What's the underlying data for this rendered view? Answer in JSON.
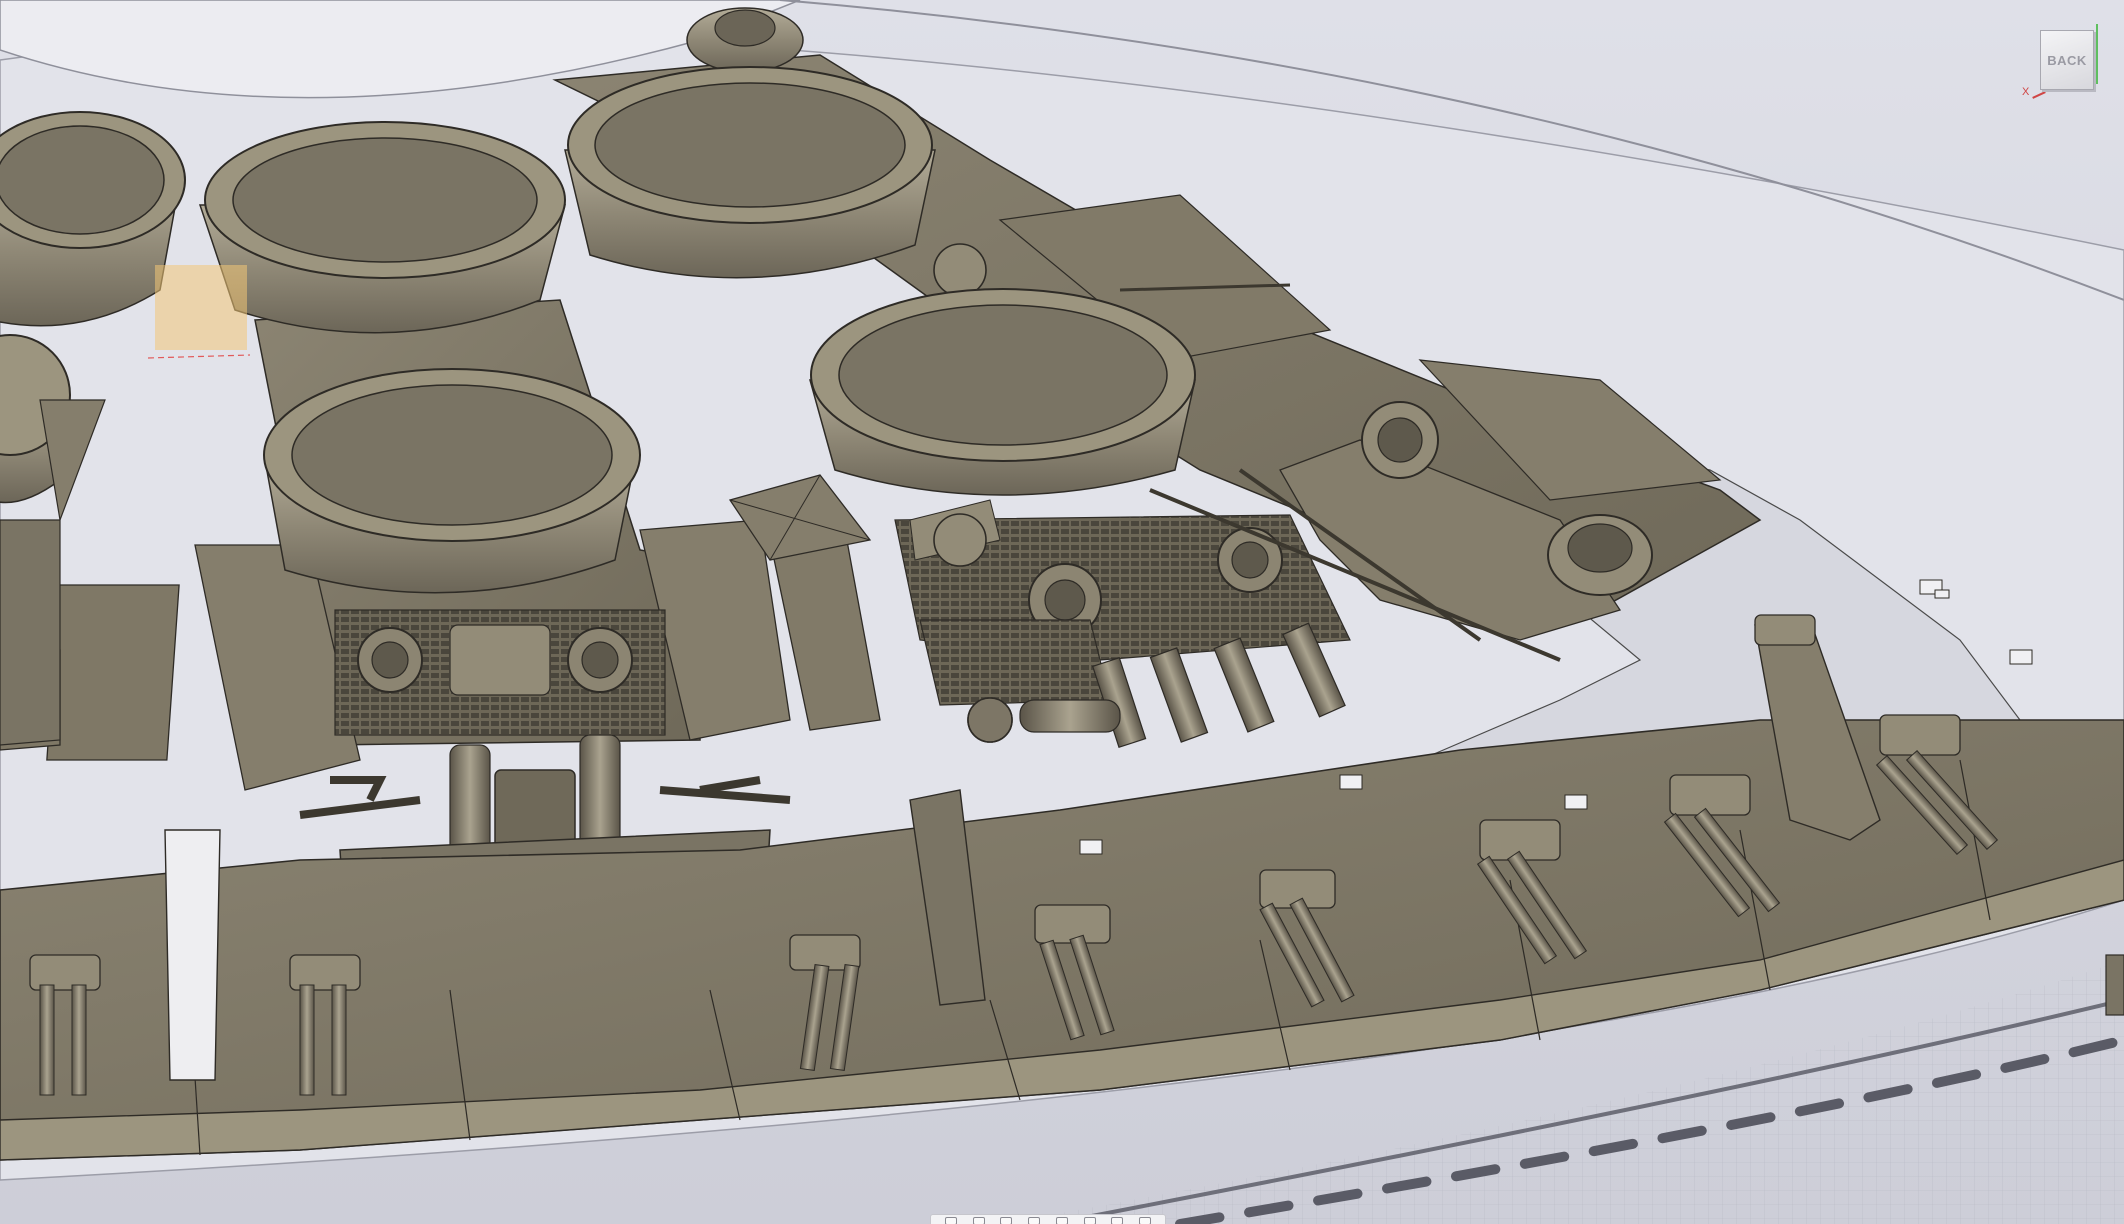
{
  "viewcube": {
    "face_label": "BACK",
    "x_axis_label": "X"
  },
  "navbar": {
    "tools": [
      "orbit-icon",
      "pan-icon",
      "look-at-icon",
      "zoom-icon",
      "fit-icon",
      "display-settings-icon",
      "grid-settings-icon",
      "viewports-icon"
    ]
  },
  "colors": {
    "background": "#dcdde6",
    "model_base": "#7d7666",
    "model_light": "#a69e8a",
    "model_dark": "#4b463c",
    "edge": "#2e2b26",
    "sketch_line": "#4a4a4a",
    "selection": "#f2c777"
  }
}
